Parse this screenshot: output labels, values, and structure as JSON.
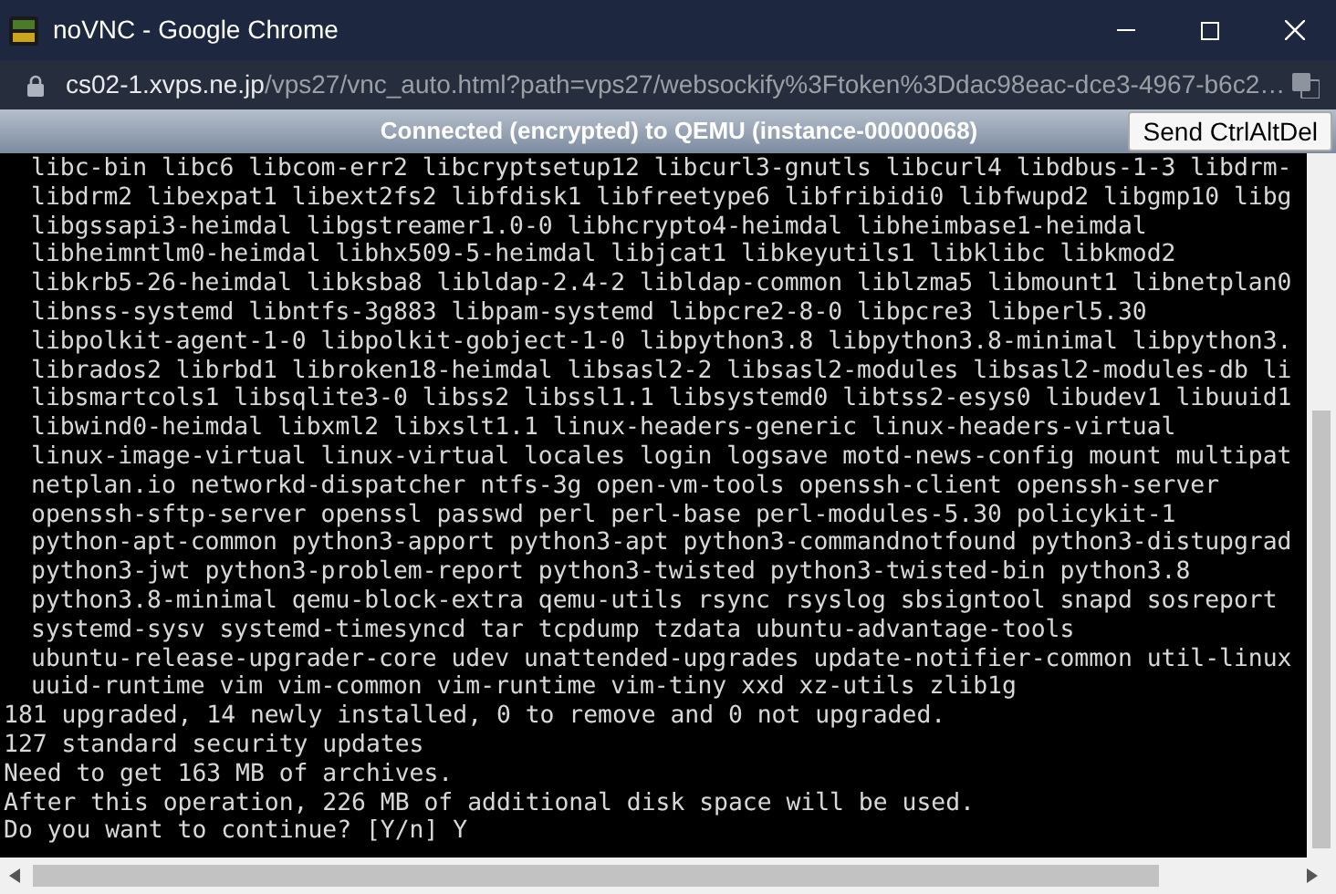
{
  "window": {
    "title": "noVNC - Google Chrome"
  },
  "address_bar": {
    "host": "cs02-1.xvps.ne.jp",
    "path": "/vps27/vnc_auto.html?path=vps27/websockify%3Ftoken%3Ddac98eac-dce3-4967-b6c2…"
  },
  "status_bar": {
    "text": "Connected (encrypted) to QEMU (instance-00000068)",
    "button": "Send CtrlAltDel"
  },
  "terminal": {
    "lines": [
      {
        "kind": "indented",
        "text": "libc-bin libc6 libcom-err2 libcryptsetup12 libcurl3-gnutls libcurl4 libdbus-1-3 libdrm-"
      },
      {
        "kind": "indented",
        "text": "libdrm2 libexpat1 libext2fs2 libfdisk1 libfreetype6 libfribidi0 libfwupd2 libgmp10 libg"
      },
      {
        "kind": "indented",
        "text": "libgssapi3-heimdal libgstreamer1.0-0 libhcrypto4-heimdal libheimbase1-heimdal"
      },
      {
        "kind": "indented",
        "text": "libheimntlm0-heimdal libhx509-5-heimdal libjcat1 libkeyutils1 libklibc libkmod2"
      },
      {
        "kind": "indented",
        "text": "libkrb5-26-heimdal libksba8 libldap-2.4-2 libldap-common liblzma5 libmount1 libnetplan0"
      },
      {
        "kind": "indented",
        "text": "libnss-systemd libntfs-3g883 libpam-systemd libpcre2-8-0 libpcre3 libperl5.30"
      },
      {
        "kind": "indented",
        "text": "libpolkit-agent-1-0 libpolkit-gobject-1-0 libpython3.8 libpython3.8-minimal libpython3."
      },
      {
        "kind": "indented",
        "text": "librados2 librbd1 libroken18-heimdal libsasl2-2 libsasl2-modules libsasl2-modules-db li"
      },
      {
        "kind": "indented",
        "text": "libsmartcols1 libsqlite3-0 libss2 libssl1.1 libsystemd0 libtss2-esys0 libudev1 libuuid1"
      },
      {
        "kind": "indented",
        "text": "libwind0-heimdal libxml2 libxslt1.1 linux-headers-generic linux-headers-virtual"
      },
      {
        "kind": "indented",
        "text": "linux-image-virtual linux-virtual locales login logsave motd-news-config mount multipat"
      },
      {
        "kind": "indented",
        "text": "netplan.io networkd-dispatcher ntfs-3g open-vm-tools openssh-client openssh-server"
      },
      {
        "kind": "indented",
        "text": "openssh-sftp-server openssl passwd perl perl-base perl-modules-5.30 policykit-1"
      },
      {
        "kind": "indented",
        "text": "python-apt-common python3-apport python3-apt python3-commandnotfound python3-distupgrad"
      },
      {
        "kind": "indented",
        "text": "python3-jwt python3-problem-report python3-twisted python3-twisted-bin python3.8"
      },
      {
        "kind": "indented",
        "text": "python3.8-minimal qemu-block-extra qemu-utils rsync rsyslog sbsigntool snapd sosreport"
      },
      {
        "kind": "indented",
        "text": "systemd-sysv systemd-timesyncd tar tcpdump tzdata ubuntu-advantage-tools"
      },
      {
        "kind": "indented",
        "text": "ubuntu-release-upgrader-core udev unattended-upgrades update-notifier-common util-linux"
      },
      {
        "kind": "indented",
        "text": "uuid-runtime vim vim-common vim-runtime vim-tiny xxd xz-utils zlib1g"
      },
      {
        "kind": "plain",
        "text": "181 upgraded, 14 newly installed, 0 to remove and 0 not upgraded."
      },
      {
        "kind": "plain",
        "text": "127 standard security updates"
      },
      {
        "kind": "plain",
        "text": "Need to get 163 MB of archives."
      },
      {
        "kind": "plain",
        "text": "After this operation, 226 MB of additional disk space will be used."
      },
      {
        "kind": "plain",
        "text": "Do you want to continue? [Y/n] Y"
      }
    ]
  }
}
